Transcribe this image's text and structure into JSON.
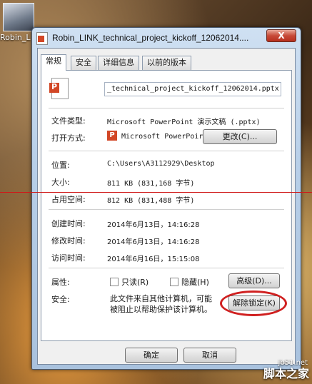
{
  "desktop": {
    "icon_label": "Robin_L"
  },
  "window": {
    "title": "Robin_LINK_technical_project_kickoff_12062014....",
    "close_glyph": "X"
  },
  "tabs": [
    "常规",
    "安全",
    "详细信息",
    "以前的版本"
  ],
  "general": {
    "filename": "_technical_project_kickoff_12062014.pptx",
    "file_type_label": "文件类型:",
    "file_type_value": "Microsoft PowerPoint 演示文稿 (.pptx)",
    "open_with_label": "打开方式:",
    "open_with_value": "Microsoft PowerPoir",
    "change_button": "更改(C)...",
    "location_label": "位置:",
    "location_value": "C:\\Users\\A3112929\\Desktop",
    "size_label": "大小:",
    "size_value": "811 KB (831,168 字节)",
    "disk_size_label": "占用空间:",
    "disk_size_value": "812 KB (831,488 字节)",
    "created_label": "创建时间:",
    "created_value": "2014年6月13日，14:16:28",
    "modified_label": "修改时间:",
    "modified_value": "2014年6月13日，14:16:28",
    "accessed_label": "访问时间:",
    "accessed_value": "2014年6月16日，15:15:08",
    "attributes_label": "属性:",
    "readonly_label": "只读(R)",
    "hidden_label": "隐藏(H)",
    "advanced_button": "高级(D)...",
    "security_label": "安全:",
    "security_text_line1": "此文件来自其他计算机，可能",
    "security_text_line2": "被阻止以帮助保护该计算机。",
    "unblock_button": "解除锁定(K)"
  },
  "footer": {
    "ok_button": "确定",
    "cancel_button": "取消"
  },
  "watermark": {
    "site": "脚本之家",
    "url": "jb51.net"
  },
  "colors": {
    "ppt_orange": "#d24726",
    "annotation_red": "#d02020"
  }
}
